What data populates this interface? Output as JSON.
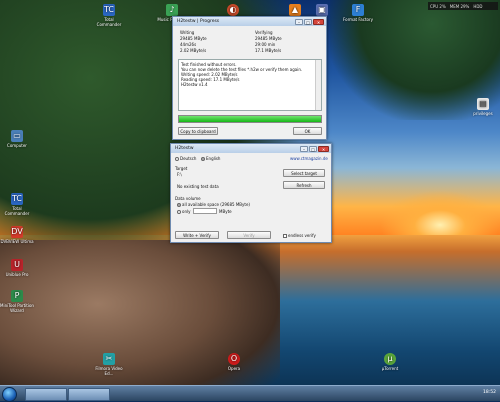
{
  "desktop": {
    "icons": [
      {
        "label": "Total Commander",
        "glyph": "TC"
      },
      {
        "label": "Music Portable",
        "glyph": "♪"
      },
      {
        "label": "",
        "glyph": "◐"
      },
      {
        "label": "",
        "glyph": "▲"
      },
      {
        "label": "",
        "glyph": "▣"
      },
      {
        "label": "Format Factory",
        "glyph": "F"
      },
      {
        "label": "Computer",
        "glyph": "▭"
      },
      {
        "label": "Total Commander",
        "glyph": "TC"
      },
      {
        "label": "DVBVIEW Ultima",
        "glyph": "DV"
      },
      {
        "label": "Uniblue Pro",
        "glyph": "U"
      },
      {
        "label": "MiniTool Partition Wizard",
        "glyph": "P"
      },
      {
        "label": "Filmora Video Ed...",
        "glyph": "✂"
      },
      {
        "label": "Opera",
        "glyph": "O"
      },
      {
        "label": "µTorrent",
        "glyph": "µ"
      },
      {
        "label": "privileges",
        "glyph": "▤"
      }
    ]
  },
  "tray_top": {
    "items": [
      "CPU 2%",
      "MEM 29%",
      "HDD"
    ]
  },
  "progress_window": {
    "title": "H2testw | Progress",
    "writing_label": "Writing",
    "writing_value1": "29485 MByte",
    "writing_value2": "44m26s",
    "writing_value3": "2.02 MByte/s",
    "verifying_label": "Verifying",
    "verifying_value1": "29485 MByte",
    "verifying_value2": "29:00 min",
    "verifying_value3": "17.1 MByte/s",
    "log_line1": "Test finished without errors.",
    "log_line2": "You can now delete the test files *.h2w or verify them again.",
    "log_line3": "Writing speed: 2.02 MByte/s",
    "log_line4": "Reading speed: 17.1 MByte/s",
    "log_line5": "H2testw v1.4",
    "progress": 1.0,
    "copy_label": "Copy to clipboard",
    "ok_label": "OK"
  },
  "main_window": {
    "title": "H2testw",
    "lang_de": "Deutsch",
    "lang_en": "English",
    "website": "www.ctmagazin.de",
    "target_label": "Target",
    "target_value": "F:\\",
    "select_target": "Select target",
    "no_test_data": "No existing test data",
    "refresh": "Refresh",
    "data_volume": "Data volume",
    "all_space": "all available space (29685 MByte)",
    "only_label": "only",
    "only_unit": "MByte",
    "write_verify": "Write + Verify",
    "verify": "Verify",
    "endless_verify": "endless verify"
  },
  "taskbar": {
    "clock": "18:52"
  }
}
